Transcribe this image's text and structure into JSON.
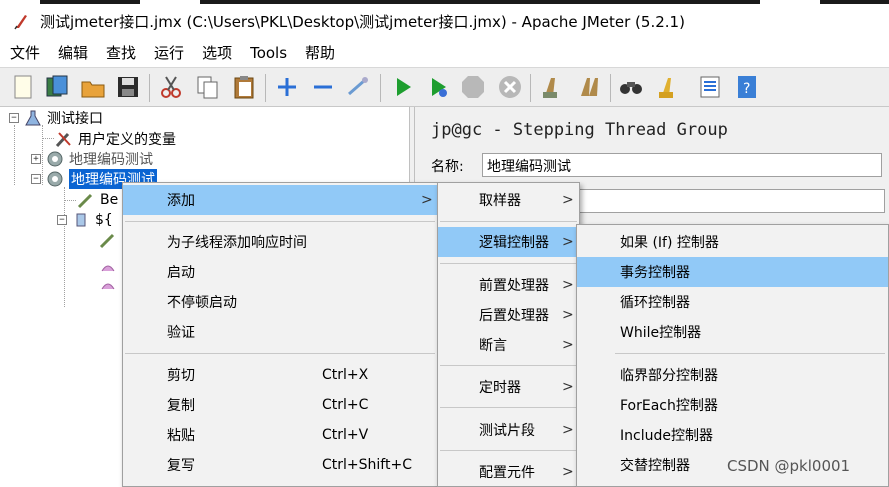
{
  "window": {
    "title": "测试jmeter接口.jmx (C:\\Users\\PKL\\Desktop\\测试jmeter接口.jmx) - Apache JMeter (5.2.1)",
    "icon": "jmeter-feather-icon"
  },
  "menubar": {
    "items": [
      "文件",
      "编辑",
      "查找",
      "运行",
      "选项",
      "Tools",
      "帮助"
    ]
  },
  "toolbar": {
    "buttons": [
      "new-icon",
      "templates-icon",
      "open-icon",
      "save-icon",
      "cut-icon",
      "copy-icon",
      "paste-icon",
      "expand-icon",
      "collapse-icon",
      "toggle-icon",
      "start-icon",
      "start-no-pause-icon",
      "stop-icon",
      "shutdown-icon",
      "clear-icon",
      "clear-all-icon",
      "search-icon",
      "reset-search-icon",
      "function-helper-icon",
      "help-icon"
    ]
  },
  "tree": {
    "root": "测试接口",
    "nodes": [
      {
        "label": "用户定义的变量",
        "icon": "wrench-icon"
      },
      {
        "label": "地理编码测试",
        "icon": "gear-icon"
      },
      {
        "label": "地理编码测试",
        "icon": "gear-icon"
      },
      {
        "label": "Be",
        "icon": "pipette-icon"
      },
      {
        "label": "${",
        "icon": "controller-icon"
      }
    ]
  },
  "panel": {
    "title": "jp@gc - Stepping Thread Group",
    "name_label": "名称:",
    "name_value": "地理编码测试"
  },
  "context_menu": {
    "items": [
      {
        "label": "添加",
        "submenu": true
      },
      {
        "label": "为子线程添加响应时间"
      },
      {
        "label": "启动"
      },
      {
        "label": "不停顿启动"
      },
      {
        "label": "验证"
      },
      {
        "label": "剪切",
        "shortcut": "Ctrl+X"
      },
      {
        "label": "复制",
        "shortcut": "Ctrl+C"
      },
      {
        "label": "粘贴",
        "shortcut": "Ctrl+V"
      },
      {
        "label": "复写",
        "shortcut": "Ctrl+Shift+C"
      }
    ]
  },
  "add_submenu": {
    "items": [
      {
        "label": "取样器"
      },
      {
        "label": "逻辑控制器"
      },
      {
        "label": "前置处理器"
      },
      {
        "label": "后置处理器"
      },
      {
        "label": "断言"
      },
      {
        "label": "定时器"
      },
      {
        "label": "测试片段"
      },
      {
        "label": "配置元件"
      }
    ]
  },
  "logic_submenu": {
    "items": [
      {
        "label": "如果 (If) 控制器"
      },
      {
        "label": "事务控制器"
      },
      {
        "label": "循环控制器"
      },
      {
        "label": "While控制器"
      },
      {
        "label": "临界部分控制器"
      },
      {
        "label": "ForEach控制器"
      },
      {
        "label": "Include控制器"
      },
      {
        "label": "交替控制器"
      }
    ]
  },
  "arrow": ">",
  "watermark": "CSDN @pkl0001",
  "colors": {
    "highlight": "#91c9f7",
    "selection": "#0a64d2"
  }
}
